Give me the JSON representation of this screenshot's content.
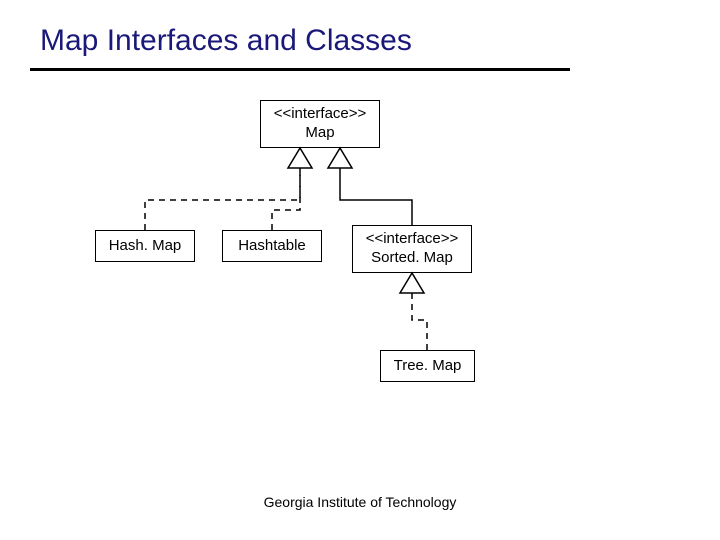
{
  "title": "Map Interfaces and Classes",
  "footer": "Georgia Institute of Technology",
  "nodes": {
    "map": {
      "stereotype": "<<interface>>",
      "name": "Map"
    },
    "hashmap": {
      "name": "Hash. Map"
    },
    "hashtable": {
      "name": "Hashtable"
    },
    "sortedmap": {
      "stereotype": "<<interface>>",
      "name": "Sorted. Map"
    },
    "treemap": {
      "name": "Tree. Map"
    }
  }
}
